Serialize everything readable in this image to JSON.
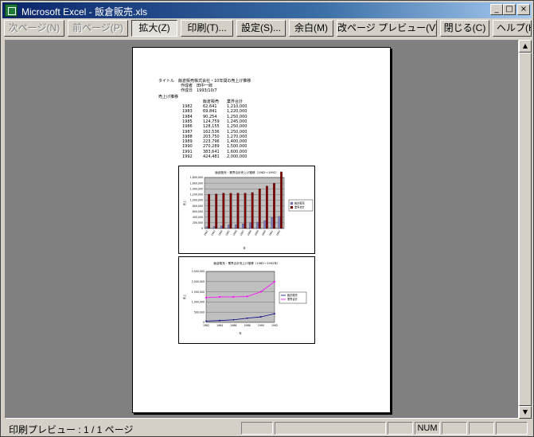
{
  "window": {
    "title": "Microsoft Excel - 飯倉販売.xls"
  },
  "toolbar": {
    "next_label": "次ページ(N)",
    "prev_label": "前ページ(P)",
    "zoom_label": "拡大(Z)",
    "print_label": "印刷(T)...",
    "setup_label": "設定(S)...",
    "margins_label": "余白(M)",
    "pagebreak_label": "改ページ プレビュー(V)",
    "close_label": "閉じる(C)",
    "help_label": "ヘルプ(H)"
  },
  "page": {
    "header_lines": [
      "タイトル　飯倉販売株式会社・10年間の売上げ推移",
      "作成者　田中一郎",
      "作成日　1993/10/7"
    ],
    "section_label": "売上げ推移",
    "table_headers": [
      "飯倉販売",
      "業界合計"
    ],
    "rows": [
      [
        "1982",
        "62,641",
        "1,210,000"
      ],
      [
        "1983",
        "69,841",
        "1,220,000"
      ],
      [
        "1984",
        "90,254",
        "1,250,000"
      ],
      [
        "1985",
        "124,759",
        "1,245,000"
      ],
      [
        "1986",
        "128,155",
        "1,250,000"
      ],
      [
        "1987",
        "162,536",
        "1,250,000"
      ],
      [
        "1988",
        "203,750",
        "1,270,000"
      ],
      [
        "1989",
        "223,796",
        "1,400,000"
      ],
      [
        "1990",
        "270,289",
        "1,500,000"
      ],
      [
        "1991",
        "383,641",
        "1,600,000"
      ],
      [
        "1992",
        "424,481",
        "2,000,000"
      ]
    ]
  },
  "chart_data": [
    {
      "type": "bar",
      "title": "飯倉販売・業界合計売上げ推移（1982～1992）",
      "ylabel": "売上",
      "xlabel": "年",
      "categories": [
        "1982",
        "1983",
        "1984",
        "1985",
        "1986",
        "1987",
        "1988",
        "1989",
        "1990",
        "1991",
        "1992"
      ],
      "series": [
        {
          "name": "飯倉販売",
          "values": [
            62641,
            69841,
            90254,
            124759,
            128155,
            162536,
            203750,
            223796,
            270289,
            383641,
            424481
          ]
        },
        {
          "name": "業界合計",
          "values": [
            1210000,
            1220000,
            1250000,
            1245000,
            1250000,
            1250000,
            1270000,
            1400000,
            1500000,
            1600000,
            2000000
          ]
        }
      ],
      "ylim": [
        0,
        1800000
      ],
      "yticks": [
        "0",
        "200,000",
        "400,000",
        "600,000",
        "800,000",
        "1,000,000",
        "1,200,000",
        "1,400,000",
        "1,600,000",
        "1,800,000"
      ],
      "legend": "right"
    },
    {
      "type": "line",
      "title": "飯倉販売・業界合計売上げ推移（1982～1992年）",
      "ylabel": "売上",
      "xlabel": "年",
      "x": [
        "1982",
        "1984",
        "1986",
        "1988",
        "1990",
        "1992"
      ],
      "series": [
        {
          "name": "飯倉販売",
          "values": [
            62641,
            90254,
            128155,
            203750,
            270289,
            424481
          ]
        },
        {
          "name": "業界合計",
          "values": [
            1210000,
            1250000,
            1250000,
            1270000,
            1500000,
            2000000
          ]
        }
      ],
      "ylim": [
        0,
        2500000
      ],
      "yticks": [
        "0",
        "500,000",
        "1,000,000",
        "1,500,000",
        "2,000,000",
        "2,500,000"
      ],
      "legend": "right",
      "colors": {
        "飯倉販売": "#000080",
        "業界合計": "#ff00ff"
      }
    }
  ],
  "status": {
    "text": "印刷プレビュー : 1 / 1 ページ",
    "num_indicator": "NUM"
  }
}
